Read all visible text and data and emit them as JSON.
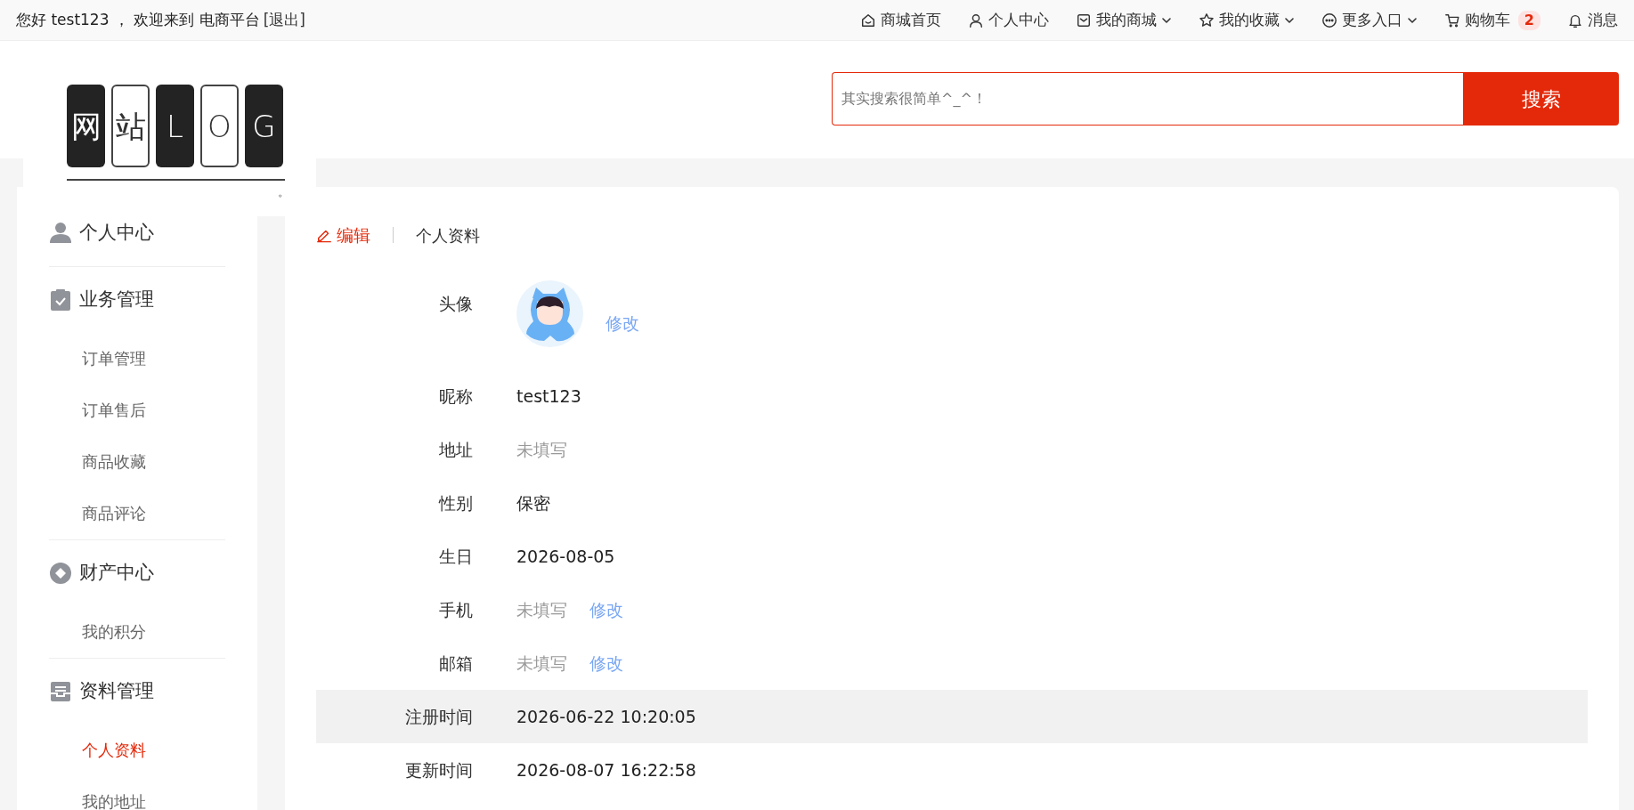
{
  "topbar": {
    "greeting": "您好 test123 ， 欢迎来到 电商平台",
    "logout": "[退出]",
    "links": [
      {
        "label": "商城首页",
        "dropdown": false
      },
      {
        "label": "个人中心",
        "dropdown": false
      },
      {
        "label": "我的商城",
        "dropdown": true
      },
      {
        "label": "我的收藏",
        "dropdown": true
      },
      {
        "label": "更多入口",
        "dropdown": true
      },
      {
        "label": "购物车",
        "badge": "2",
        "dropdown": false
      },
      {
        "label": "消息",
        "dropdown": false
      }
    ]
  },
  "logo": {
    "tiles": [
      {
        "text": "网",
        "dark": true
      },
      {
        "text": "站",
        "dark": false
      },
      {
        "text": "L",
        "dark": true
      },
      {
        "text": "O",
        "dark": false
      },
      {
        "text": "G",
        "dark": true
      }
    ],
    "mark": "。"
  },
  "search": {
    "placeholder": "其实搜索很简单^_^！",
    "button": "搜索"
  },
  "sidebar": {
    "groups": [
      {
        "title": "个人中心"
      },
      {
        "title": "业务管理",
        "items": [
          {
            "label": "订单管理",
            "selected": false
          },
          {
            "label": "订单售后",
            "selected": false
          },
          {
            "label": "商品收藏",
            "selected": false
          },
          {
            "label": "商品评论",
            "selected": false
          }
        ]
      },
      {
        "title": "财产中心",
        "items": [
          {
            "label": "我的积分",
            "selected": false
          }
        ]
      },
      {
        "title": "资料管理",
        "items": [
          {
            "label": "个人资料",
            "selected": true
          },
          {
            "label": "我的地址",
            "selected": false
          }
        ]
      }
    ]
  },
  "profile": {
    "edit": "编辑",
    "title": "个人资料",
    "rows": [
      {
        "kind": "avatar",
        "label": "头像",
        "action": "修改",
        "highlighted": false
      },
      {
        "kind": "text",
        "label": "昵称",
        "value": "test123",
        "empty": false,
        "highlighted": false
      },
      {
        "kind": "text",
        "label": "地址",
        "value": "未填写",
        "empty": true,
        "highlighted": false
      },
      {
        "kind": "text",
        "label": "性别",
        "value": "保密",
        "empty": false,
        "highlighted": false
      },
      {
        "kind": "text",
        "label": "生日",
        "value": "2026-08-05",
        "empty": false,
        "highlighted": false
      },
      {
        "kind": "text",
        "label": "手机",
        "value": "未填写",
        "empty": true,
        "action": "修改",
        "highlighted": false
      },
      {
        "kind": "text",
        "label": "邮箱",
        "value": "未填写",
        "empty": true,
        "action": "修改",
        "highlighted": false
      },
      {
        "kind": "text",
        "label": "注册时间",
        "value": "2026-06-22 10:20:05",
        "empty": false,
        "highlighted": true
      },
      {
        "kind": "text",
        "label": "更新时间",
        "value": "2026-08-07 16:22:58",
        "empty": false,
        "highlighted": false
      }
    ]
  }
}
